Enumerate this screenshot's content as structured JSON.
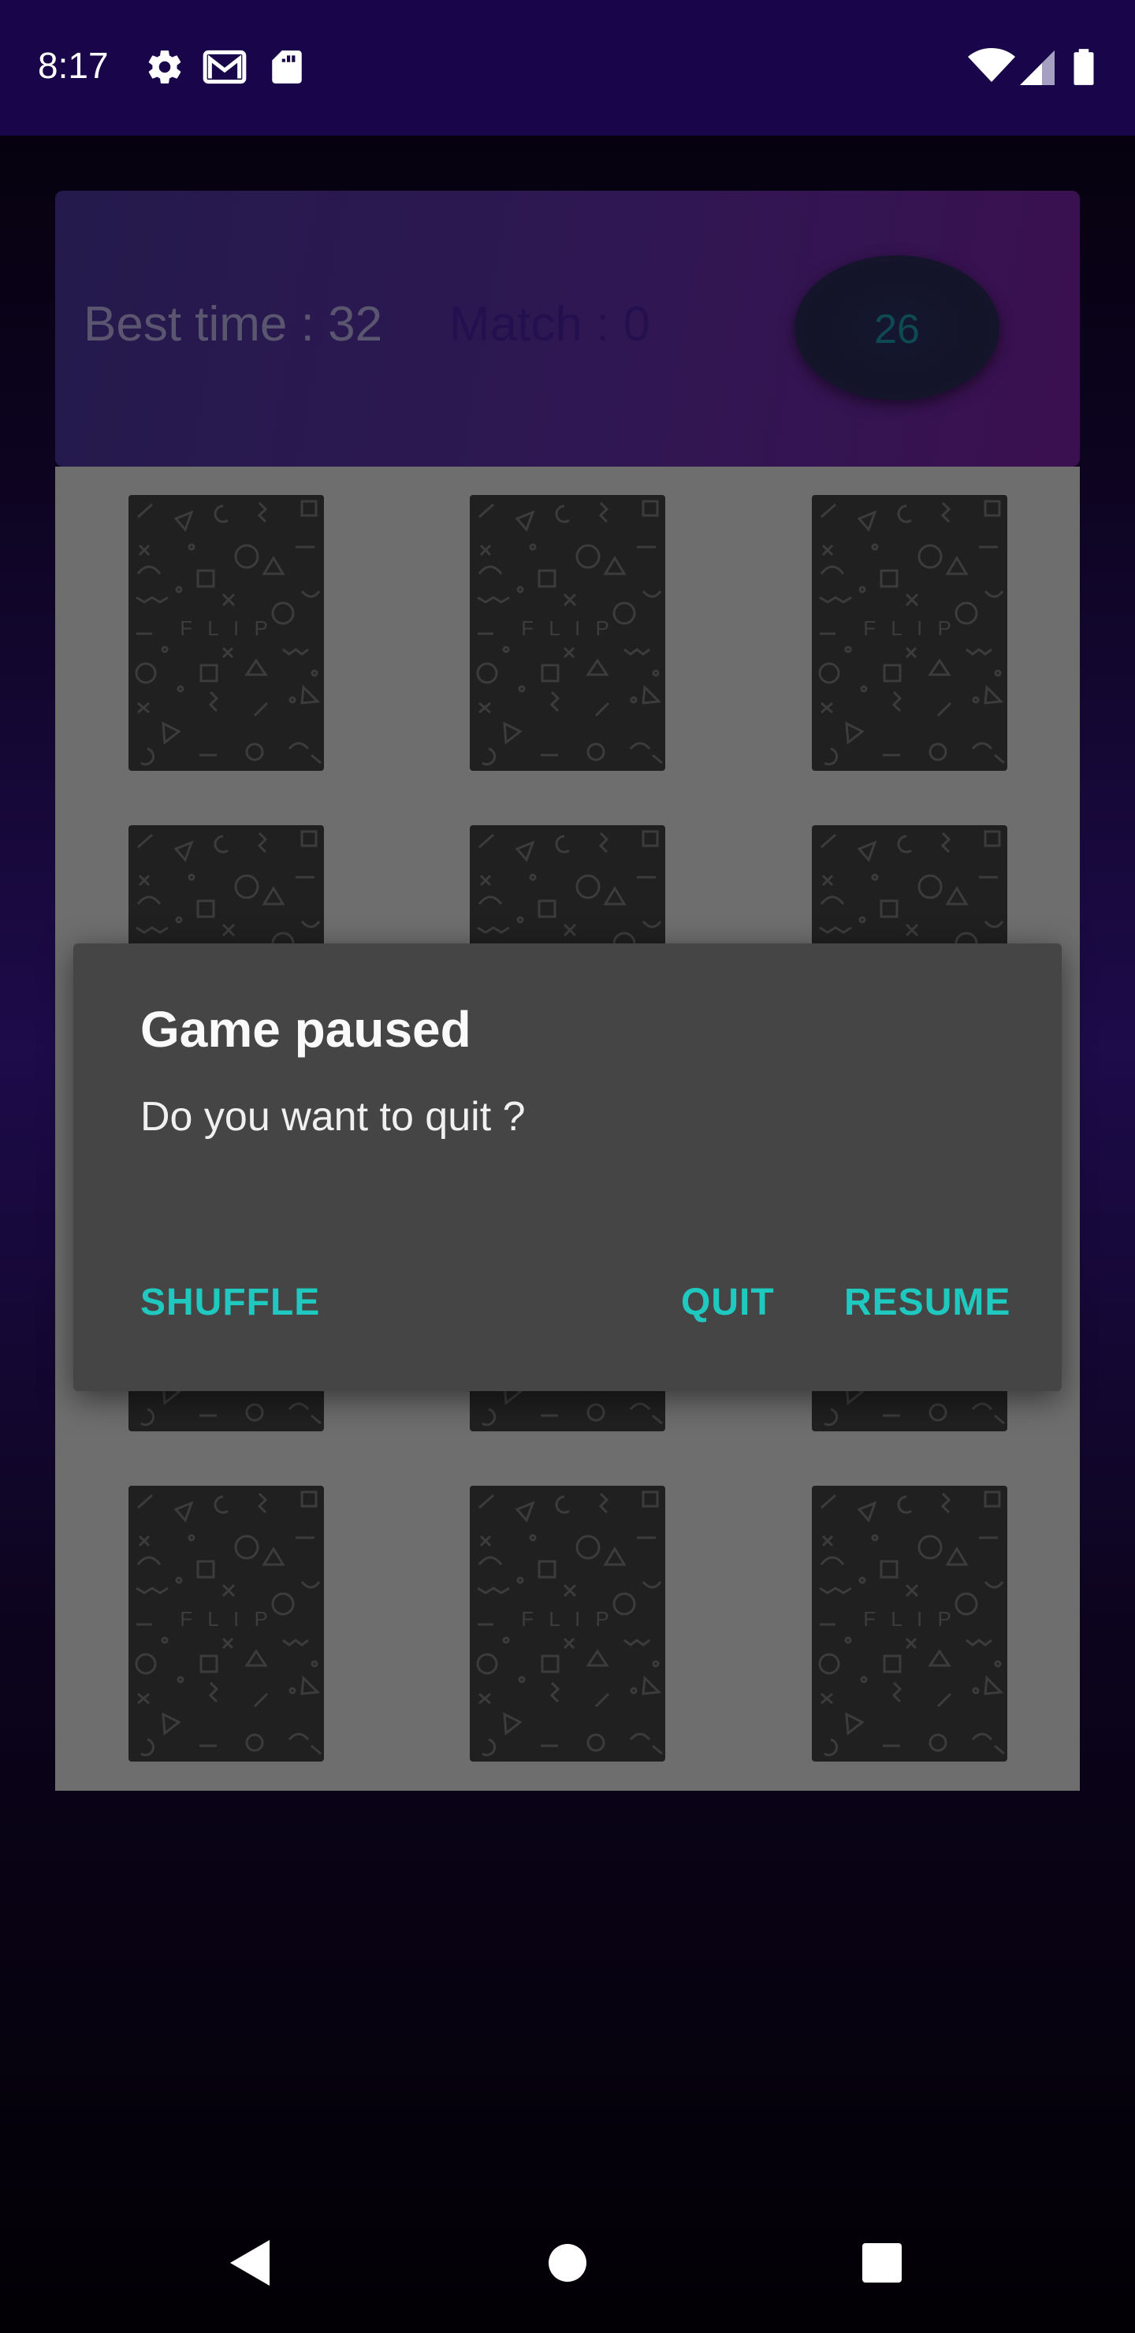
{
  "status_bar": {
    "time": "8:17",
    "left_icons": [
      "gear-icon",
      "gmail-icon",
      "sd-card-icon"
    ],
    "right_icons": [
      "wifi-icon",
      "cell-signal-icon",
      "battery-icon"
    ]
  },
  "game": {
    "best_time_label": "Best time : 32",
    "match_label": "Match : 0",
    "timer_value": "26",
    "card_back_text": "F L I P",
    "card_count": 12
  },
  "dialog": {
    "title": "Game paused",
    "message": "Do you want to quit ?",
    "shuffle_label": "SHUFFLE",
    "quit_label": "QUIT",
    "resume_label": "RESUME",
    "accent_color": "#1fc9bf"
  },
  "nav_bar": {
    "buttons": [
      "back-icon",
      "home-icon",
      "recents-icon"
    ]
  }
}
